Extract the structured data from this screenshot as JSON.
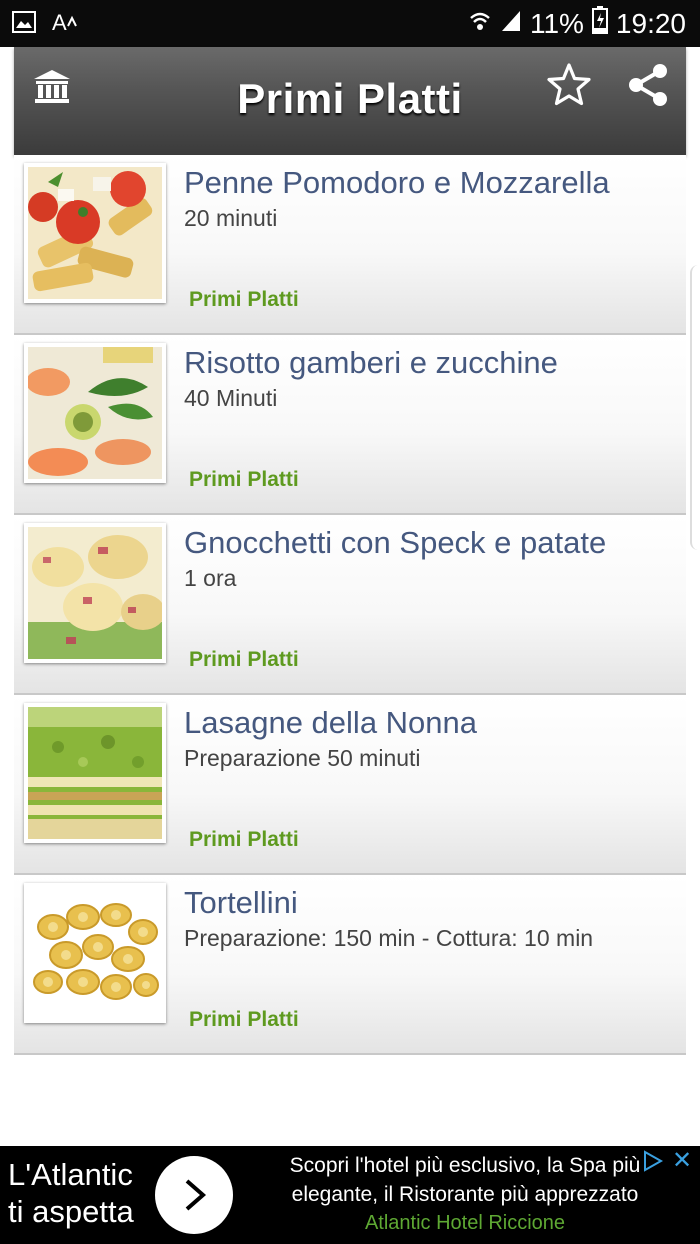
{
  "status_bar": {
    "battery": "11%",
    "time": "19:20"
  },
  "action_bar": {
    "title": "Primi Platti"
  },
  "recipes": [
    {
      "title": "Penne Pomodoro e Mozzarella",
      "subtitle": "20 minuti",
      "category": "Primi Platti"
    },
    {
      "title": "Risotto gamberi e zucchine",
      "subtitle": "40 Minuti",
      "category": "Primi Platti"
    },
    {
      "title": "Gnocchetti con Speck e patate",
      "subtitle": "1 ora",
      "category": "Primi Platti"
    },
    {
      "title": "Lasagne della Nonna",
      "subtitle": "Preparazione 50 minuti",
      "category": "Primi Platti"
    },
    {
      "title": "Tortellini",
      "subtitle": "Preparazione: 150 min - Cottura: 10 min",
      "category": "Primi Platti"
    }
  ],
  "ad": {
    "left_line1": "L'Atlantic",
    "left_line2": "ti aspetta",
    "line1": "Scopri l'hotel più esclusivo, la Spa più",
    "line2": "elegante, il Ristorante più apprezzato",
    "line3": "Atlantic Hotel Riccione"
  },
  "colors": {
    "title_blue": "#45587f",
    "category_green": "#5e9a1f",
    "ad_green": "#5ea833"
  },
  "icons": [
    "image-icon",
    "font-icon",
    "wifi-icon",
    "signal-icon",
    "battery-icon",
    "bank-icon",
    "star-icon",
    "share-icon",
    "chevron-right-icon",
    "adchoices-icon",
    "close-icon"
  ]
}
